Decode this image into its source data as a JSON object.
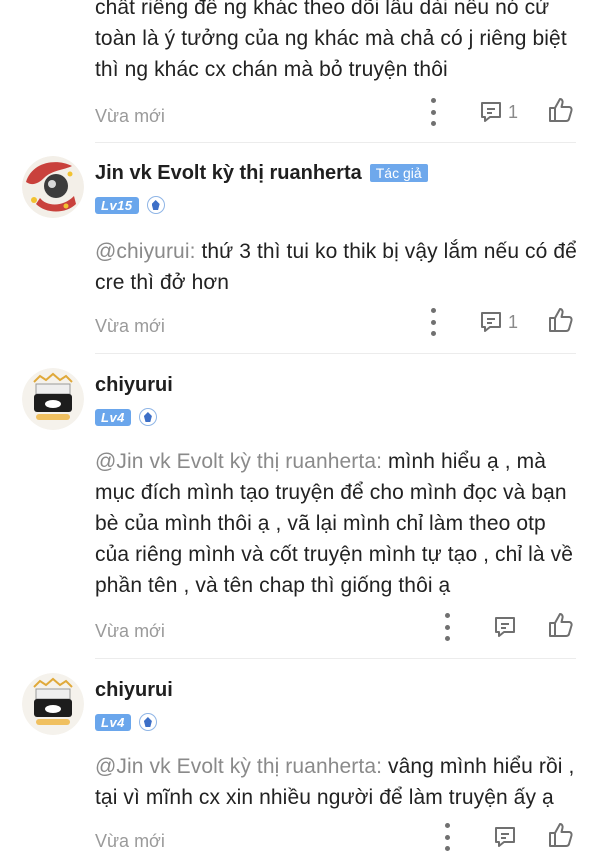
{
  "comments": [
    {
      "text": "chất riêng để ng khác theo dõi lâu dài nếu nó cứ toàn là ý tưởng của ng khác mà chả có j riêng biệt thì ng khác cx chán mà bỏ truyện thôi",
      "lines": [
        "chất riêng để ng khác theo dõi lâu dài nếu nó cứ",
        "toàn là ý tưởng của ng khác mà chả có j riêng biệt",
        "thì ng khác cx chán mà bỏ truyện thôi"
      ],
      "time": "Vừa mới",
      "reply_count": "1"
    },
    {
      "author": "Jin vk Evolt kỳ thị ruanherta",
      "author_tag": "Tác giả",
      "level": "Lv15",
      "mention": "@chiyurui:",
      "line1_rest": " thứ 3 thì tui ko thik bị vậy lắm nếu có để",
      "lines_after": [
        "cre thì đở hơn"
      ],
      "time": "Vừa mới",
      "reply_count": "1"
    },
    {
      "author": "chiyurui",
      "level": "Lv4",
      "mention": "@Jin vk Evolt kỳ thị ruanherta:",
      "line1_rest": " mình hiểu ạ , mà",
      "lines_after": [
        "mục đích mình tạo truyện để cho mình đọc và bạn",
        "bè của mình thôi ạ , vã lại mình chỉ làm theo otp",
        "của riêng mình và cốt truyện mình tự tạo , chỉ là về",
        "phần tên , và tên chap thì giống thôi ạ"
      ],
      "time": "Vừa mới"
    },
    {
      "author": "chiyurui",
      "level": "Lv4",
      "mention": "@Jin vk Evolt kỳ thị ruanherta:",
      "line1_rest": " vâng mình hiểu rồi ,",
      "lines_after": [
        "tại vì mĩnh cx xin nhiều người để làm truyện ấy ạ"
      ],
      "time": "Vừa mới"
    }
  ],
  "icons": {
    "more": "kebab-vertical-icon",
    "reply": "comment-reply-icon",
    "like": "thumbs-up-icon"
  },
  "colors": {
    "level_badge": "#6aa6ec",
    "author_tag": "#6ea8ec",
    "mention": "#8a8a8a",
    "meta": "#9a9a9a"
  }
}
